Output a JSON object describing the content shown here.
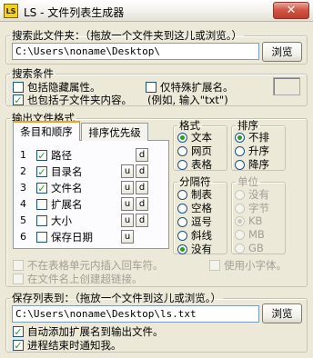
{
  "window": {
    "title": "LS - 文件列表生成器",
    "icon_text": "LS",
    "close_label": "✕"
  },
  "search": {
    "legend": "搜索此文件夹：（拖放一个文件夹到这儿或浏览。）",
    "path": "C:\\Users\\noname\\Desktop\\",
    "browse_label": "浏览"
  },
  "conditions": {
    "legend": "搜索条件",
    "include_hidden": {
      "label": "包括隐藏属性。",
      "checked": false
    },
    "special_ext": {
      "label": "仅特殊扩展名。",
      "checked": false
    },
    "include_subfolders": {
      "label": "也包括子文件夹内容。",
      "checked": true
    },
    "example": "(例如, 输入\"txt\")"
  },
  "output_format": {
    "legend": "输出文件格式",
    "tabs": [
      "条目和顺序",
      "排序优先级"
    ],
    "items": [
      {
        "num": "1",
        "label": "路径",
        "checked": true,
        "u": false,
        "d": true
      },
      {
        "num": "2",
        "label": "目录名",
        "checked": true,
        "u": true,
        "d": true
      },
      {
        "num": "3",
        "label": "文件名",
        "checked": true,
        "u": true,
        "d": true
      },
      {
        "num": "4",
        "label": "扩展名",
        "checked": false,
        "u": true,
        "d": true
      },
      {
        "num": "5",
        "label": "大小",
        "checked": false,
        "u": true,
        "d": true
      },
      {
        "num": "6",
        "label": "保存日期",
        "checked": false,
        "u": true,
        "d": false
      }
    ],
    "u_label": "u",
    "d_label": "d"
  },
  "format": {
    "legend": "格式",
    "options": [
      "文本",
      "网页",
      "表格"
    ],
    "selected": "文本"
  },
  "sort": {
    "legend": "排序",
    "options": [
      "不排",
      "升序",
      "降序"
    ],
    "selected": "不排"
  },
  "separator": {
    "legend": "分隔符",
    "options": [
      "制表",
      "空格",
      "逗号",
      "斜线",
      "没有"
    ],
    "selected": "没有"
  },
  "unit": {
    "legend": "单位",
    "options": [
      "没有",
      "字节",
      "KB",
      "MB",
      "GB"
    ],
    "selected": "KB"
  },
  "disabled_options": {
    "no_newline": "不在表格单元内插入回车符。",
    "small_font": "使用小字体。",
    "hyperlink": "在文件名上创建超链接。"
  },
  "save": {
    "legend": "保存列表到：（拖放一个文件到这儿或浏览。）",
    "path": "C:\\Users\\noname\\Desktop\\ls.txt",
    "browse_label": "浏览",
    "auto_ext": {
      "label": "自动添加扩展名到输出文件。",
      "checked": true
    },
    "notify": {
      "label": "进程结束时通知我。",
      "checked": true
    }
  },
  "colors": {
    "face": "#ece9d8",
    "check": "#21a121",
    "tab_highlight": "#f0a024",
    "border": "#7f9db9"
  }
}
